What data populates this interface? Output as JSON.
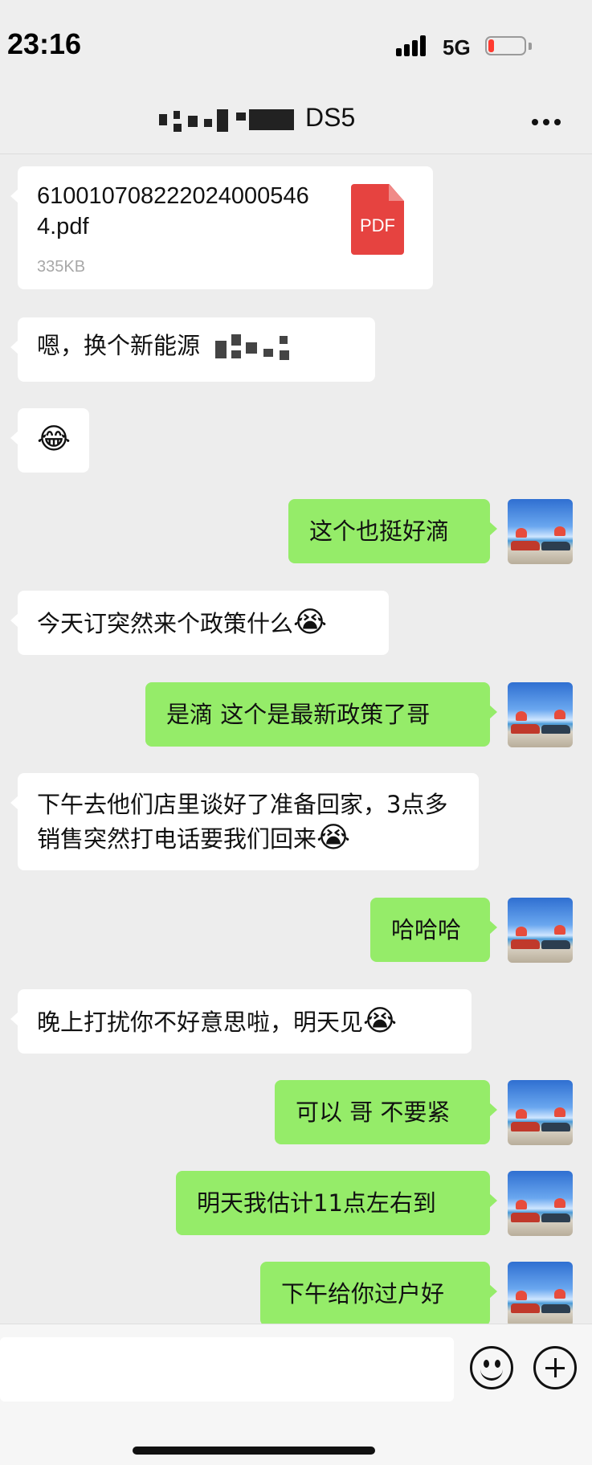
{
  "status_bar": {
    "time": "23:16",
    "network": "5G",
    "battery_color": "#ff3b30"
  },
  "nav": {
    "title": "DS5",
    "more_icon": "more-dots-icon"
  },
  "messages": [
    {
      "side": "in",
      "type": "file",
      "file_name": "6100107082220240005464.pdf",
      "file_size": "335KB",
      "icon_label": "PDF"
    },
    {
      "side": "in",
      "type": "text",
      "text": "嗯，换个新能源"
    },
    {
      "side": "in",
      "type": "text",
      "text": "😂"
    },
    {
      "side": "out",
      "type": "text",
      "text": "这个也挺好滴"
    },
    {
      "side": "in",
      "type": "text",
      "text": "今天订突然来个政策什么",
      "emoji": "😭"
    },
    {
      "side": "out",
      "type": "text",
      "text": "是滴 这个是最新政策了哥"
    },
    {
      "side": "in",
      "type": "text",
      "text": "下午去他们店里谈好了准备回家，3点多销售突然打电话要我们回来",
      "emoji": "😭"
    },
    {
      "side": "out",
      "type": "text",
      "text": "哈哈哈"
    },
    {
      "side": "in",
      "type": "text",
      "text": "晚上打扰你不好意思啦，明天见",
      "emoji": "😭"
    },
    {
      "side": "out",
      "type": "text",
      "text": "可以 哥 不要紧"
    },
    {
      "side": "out",
      "type": "text",
      "text": "明天我估计11点左右到"
    },
    {
      "side": "out",
      "type": "text",
      "text": "下午给你过户好"
    }
  ],
  "colors": {
    "outgoing_bubble": "#95ec69",
    "incoming_bubble": "#ffffff",
    "chat_background": "#ededed"
  },
  "input_bar": {
    "emoji_icon": "smiley-icon",
    "add_icon": "plus-circle-icon"
  }
}
